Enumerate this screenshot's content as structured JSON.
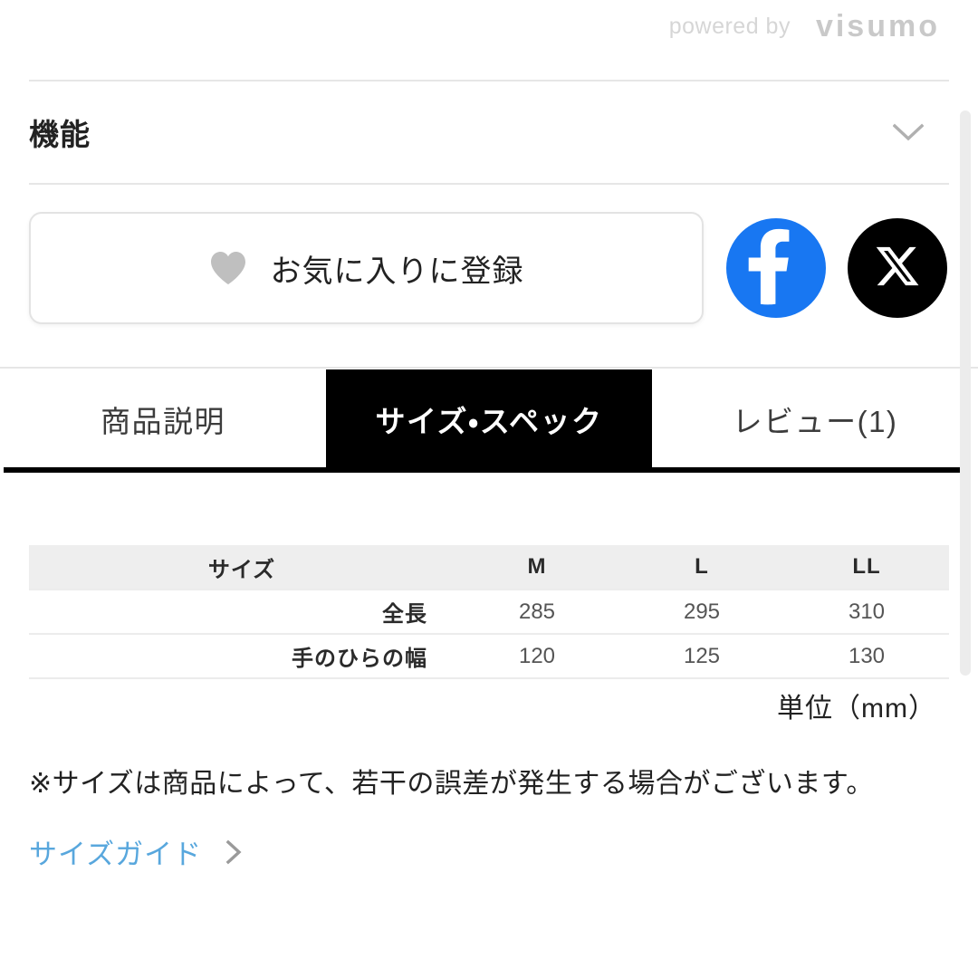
{
  "branding": {
    "powered_by_label": "powered by",
    "logo_text": "visumo"
  },
  "accordion": {
    "title": "機能",
    "toggle_icon": "chevron-down-icon"
  },
  "actions": {
    "favorite": {
      "label": "お気に入りに登録",
      "icon": "heart-icon"
    },
    "share": [
      {
        "name": "facebook",
        "icon": "facebook-icon",
        "color": "#1877f2"
      },
      {
        "name": "x-twitter",
        "icon": "x-icon",
        "color": "#000000"
      }
    ]
  },
  "tabs": [
    {
      "label": "商品説明",
      "active": false
    },
    {
      "label": "サイズ・スペック",
      "active": true
    },
    {
      "label": "レビュー(1)",
      "active": false
    }
  ],
  "spec_table": {
    "headers": [
      "サイズ",
      "M",
      "L",
      "LL"
    ],
    "rows": [
      {
        "label": "全長",
        "values": [
          "285",
          "295",
          "310"
        ]
      },
      {
        "label": "手のひらの幅",
        "values": [
          "120",
          "125",
          "130"
        ]
      }
    ],
    "unit_note": "単位（mm）"
  },
  "disclaimer": "※サイズは商品によって、若干の誤差が発生する場合がございます。",
  "size_guide": {
    "label": "サイズガイド",
    "icon": "chevron-right-icon",
    "color": "#58a7dd"
  }
}
